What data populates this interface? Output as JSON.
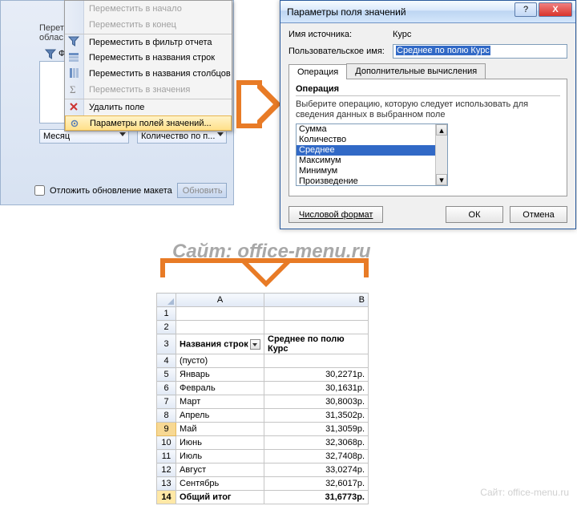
{
  "watermarks": {
    "site": "Cайт: office-menu.ru"
  },
  "leftpanel": {
    "zone_prefix": "Перет",
    "zone_suffix": "облас",
    "filter_sym": "Ф",
    "pill_rows": "Месяц",
    "pill_vals": "Количество по п...",
    "defer_label": "Отложить обновление макета",
    "refresh": "Обновить"
  },
  "ctxmenu": {
    "items": [
      {
        "label": "Переместить в начало",
        "enabled": false
      },
      {
        "label": "Переместить в конец",
        "enabled": false
      },
      {
        "label": "Переместить в фильтр отчета",
        "enabled": true,
        "sep": true,
        "icon": "funnel-icon"
      },
      {
        "label": "Переместить в названия строк",
        "enabled": true,
        "icon": "rows-icon"
      },
      {
        "label": "Переместить в названия столбцов",
        "enabled": true,
        "icon": "cols-icon"
      },
      {
        "label": "Переместить в значения",
        "enabled": false,
        "icon": "sigma-icon"
      },
      {
        "label": "Удалить поле",
        "enabled": true,
        "sep": true,
        "icon": "delete-icon"
      },
      {
        "label": "Параметры полей значений...",
        "enabled": true,
        "sep": true,
        "highlight": true,
        "icon": "settings-icon"
      }
    ]
  },
  "dialog": {
    "title": "Параметры поля значений",
    "src_label": "Имя источника:",
    "src_value": "Курс",
    "name_label": "Пользовательское имя:",
    "name_value": "Среднее по полю Курс",
    "tabs": {
      "op": "Операция",
      "extra": "Дополнительные вычисления"
    },
    "op_heading": "Операция",
    "op_help": "Выберите операцию, которую следует использовать для сведения данных в выбранном поле",
    "ops": [
      "Сумма",
      "Количество",
      "Среднее",
      "Максимум",
      "Минимум",
      "Произведение"
    ],
    "selected_op_index": 2,
    "numfmt": "Числовой формат",
    "ok": "ОК",
    "cancel": "Отмена",
    "help_sym": "?",
    "close_sym": "X"
  },
  "sheet": {
    "col_A": "A",
    "col_B": "B",
    "header_rowlabels": "Названия строк",
    "header_value": "Среднее по полю Курс",
    "rows": [
      {
        "n": 1,
        "a": "",
        "b": ""
      },
      {
        "n": 2,
        "a": "",
        "b": ""
      },
      {
        "n": 3,
        "header": true
      },
      {
        "n": 4,
        "a": "(пусто)",
        "b": ""
      },
      {
        "n": 5,
        "a": "Январь",
        "b": "30,2271р."
      },
      {
        "n": 6,
        "a": "Февраль",
        "b": "30,1631р."
      },
      {
        "n": 7,
        "a": "Март",
        "b": "30,8003р."
      },
      {
        "n": 8,
        "a": "Апрель",
        "b": "31,3502р."
      },
      {
        "n": 9,
        "a": "Май",
        "b": "31,3059р.",
        "sel": true
      },
      {
        "n": 10,
        "a": "Июнь",
        "b": "32,3068р."
      },
      {
        "n": 11,
        "a": "Июль",
        "b": "32,7408р."
      },
      {
        "n": 12,
        "a": "Август",
        "b": "33,0274р."
      },
      {
        "n": 13,
        "a": "Сентябрь",
        "b": "32,6017р."
      },
      {
        "n": 14,
        "a": "Общий итог",
        "b": "31,6773р.",
        "total": true
      }
    ]
  }
}
